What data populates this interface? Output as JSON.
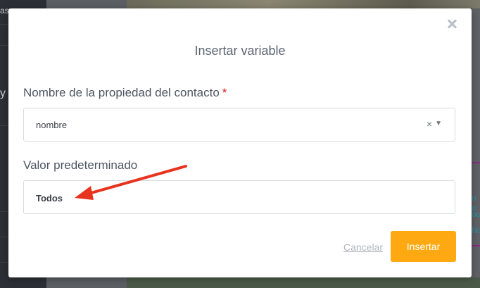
{
  "background": {
    "sidebar_fragments": [
      "as",
      "y"
    ],
    "right_fragments": [
      "n e",
      "ou",
      "Nu"
    ]
  },
  "modal": {
    "title": "Insertar variable",
    "property_field": {
      "label": "Nombre de la propiedad del contacto",
      "required_mark": "*",
      "value": "nombre",
      "clear_glyph": "×",
      "dropdown_glyph": "▼"
    },
    "default_field": {
      "label": "Valor predeterminado",
      "value": "Todos"
    },
    "footer": {
      "cancel_label": "Cancelar",
      "insert_label": "Insertar"
    }
  },
  "colors": {
    "accent": "#ffa912",
    "required": "#e0201a",
    "annotation_arrow": "#e8331e"
  },
  "icons": {
    "close": "close-icon",
    "clear": "clear-icon",
    "dropdown": "chevron-down-icon"
  }
}
